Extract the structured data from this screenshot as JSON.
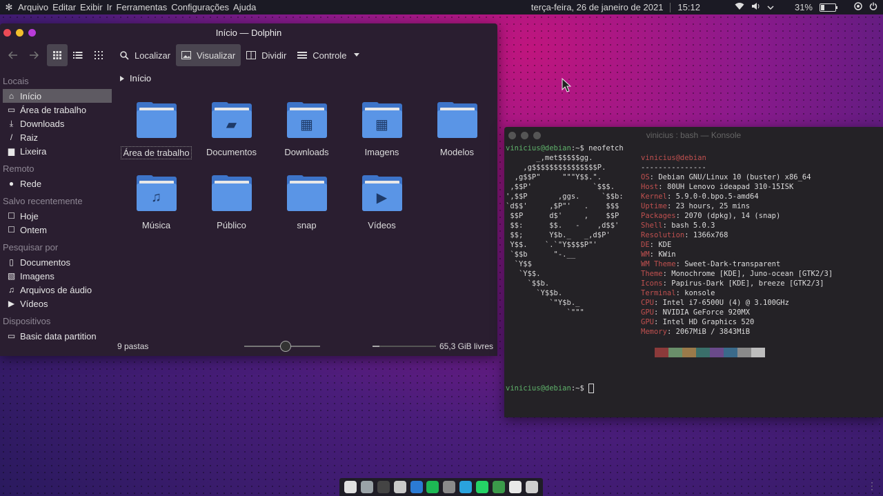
{
  "topbar": {
    "menu": [
      "Arquivo",
      "Editar",
      "Exibir",
      "Ir",
      "Ferramentas",
      "Configurações",
      "Ajuda"
    ],
    "datetime": "terça-feira, 26 de janeiro de 2021",
    "time": "15:12",
    "battery": "31%"
  },
  "dolphin": {
    "title": "Início — Dolphin",
    "toolbar": {
      "find": "Localizar",
      "preview": "Visualizar",
      "split": "Dividir",
      "control": "Controle"
    },
    "sidebar": {
      "sections": [
        {
          "title": "Locais",
          "items": [
            {
              "label": "Início",
              "icon": "home-icon",
              "selected": true
            },
            {
              "label": "Área de trabalho",
              "icon": "desktop-icon"
            },
            {
              "label": "Downloads",
              "icon": "download-icon"
            },
            {
              "label": "Raiz",
              "icon": "root-icon"
            },
            {
              "label": "Lixeira",
              "icon": "trash-icon"
            }
          ]
        },
        {
          "title": "Remoto",
          "items": [
            {
              "label": "Rede",
              "icon": "network-icon"
            }
          ]
        },
        {
          "title": "Salvo recentemente",
          "items": [
            {
              "label": "Hoje",
              "icon": "calendar-icon"
            },
            {
              "label": "Ontem",
              "icon": "calendar-icon"
            }
          ]
        },
        {
          "title": "Pesquisar por",
          "items": [
            {
              "label": "Documentos",
              "icon": "document-icon"
            },
            {
              "label": "Imagens",
              "icon": "image-icon"
            },
            {
              "label": "Arquivos de áudio",
              "icon": "audio-icon"
            },
            {
              "label": "Vídeos",
              "icon": "video-icon"
            }
          ]
        },
        {
          "title": "Dispositivos",
          "items": [
            {
              "label": "Basic data partition",
              "icon": "drive-icon"
            }
          ]
        }
      ]
    },
    "breadcrumb": "Início",
    "folders": [
      {
        "label": "Área de trabalho",
        "glyph": ""
      },
      {
        "label": "Documentos",
        "glyph": "▰"
      },
      {
        "label": "Downloads",
        "glyph": "▦"
      },
      {
        "label": "Imagens",
        "glyph": "▦"
      },
      {
        "label": "Modelos",
        "glyph": ""
      },
      {
        "label": "Música",
        "glyph": "♫"
      },
      {
        "label": "Público",
        "glyph": ""
      },
      {
        "label": "snap",
        "glyph": ""
      },
      {
        "label": "Vídeos",
        "glyph": "▶"
      }
    ],
    "status": {
      "count": "9 pastas",
      "free": "65,3 GiB livres"
    }
  },
  "konsole": {
    "title": "vinicius : bash — Konsole",
    "prompt": "vinicius@debian",
    "prompt_suffix": ":~$ ",
    "command": "neofetch",
    "user_host": "vinicius@debian",
    "separator": "---------------",
    "ascii": "       _,met$$$$$gg.\n    ,g$$$$$$$$$$$$$$$P.\n  ,g$$P\"     \"\"\"Y$$.\".\n ,$$P'              `$$$.\n',$$P       ,ggs.     `$$b:\n`d$$'     ,$P\"'   .    $$$\n $$P      d$'     ,    $$P\n $$:      $$.   -    ,d$$'\n $$;      Y$b._   _,d$P'\n Y$$.    `.`\"Y$$$$P\"'\n `$$b      \"-.__\n  `Y$$\n   `Y$$.\n     `$$b.\n       `Y$$b.\n          `\"Y$b._\n              `\"\"\"",
    "info": [
      {
        "k": "OS",
        "v": "Debian GNU/Linux 10 (buster) x86_64"
      },
      {
        "k": "Host",
        "v": "80UH Lenovo ideapad 310-15ISK"
      },
      {
        "k": "Kernel",
        "v": "5.9.0-0.bpo.5-amd64"
      },
      {
        "k": "Uptime",
        "v": "23 hours, 25 mins"
      },
      {
        "k": "Packages",
        "v": "2070 (dpkg), 14 (snap)"
      },
      {
        "k": "Shell",
        "v": "bash 5.0.3"
      },
      {
        "k": "Resolution",
        "v": "1366x768"
      },
      {
        "k": "DE",
        "v": "KDE"
      },
      {
        "k": "WM",
        "v": "KWin"
      },
      {
        "k": "WM Theme",
        "v": "Sweet-Dark-transparent"
      },
      {
        "k": "Theme",
        "v": "Monochrome [KDE], Juno-ocean [GTK2/3]"
      },
      {
        "k": "Icons",
        "v": "Papirus-Dark [KDE], breeze [GTK2/3]"
      },
      {
        "k": "Terminal",
        "v": "konsole"
      },
      {
        "k": "CPU",
        "v": "Intel i7-6500U (4) @ 3.100GHz"
      },
      {
        "k": "GPU",
        "v": "NVIDIA GeForce 920MX"
      },
      {
        "k": "GPU",
        "v": "Intel HD Graphics 520"
      },
      {
        "k": "Memory",
        "v": "2067MiB / 3843MiB"
      }
    ],
    "swatch_colors": [
      "#8b3a3a",
      "#6a8f6a",
      "#9a7a4a",
      "#3a6f6a",
      "#6a4a8a",
      "#3a6a8a",
      "#8a8a8a",
      "#bdbdbd"
    ]
  },
  "dock": {
    "apps": [
      {
        "name": "chrome-icon",
        "color": "#e0e0e0"
      },
      {
        "name": "files-icon",
        "color": "#9aa3a8"
      },
      {
        "name": "terminal-icon",
        "color": "#444"
      },
      {
        "name": "store-icon",
        "color": "#c9c9c9"
      },
      {
        "name": "vscode-icon",
        "color": "#2b7bd4"
      },
      {
        "name": "spotify-icon",
        "color": "#1db954"
      },
      {
        "name": "calculator-icon",
        "color": "#8a8a8a"
      },
      {
        "name": "telegram-icon",
        "color": "#2aa3dd"
      },
      {
        "name": "whatsapp-icon",
        "color": "#25d366"
      },
      {
        "name": "spreadsheet-icon",
        "color": "#3b9a4a"
      },
      {
        "name": "document-icon",
        "color": "#e8e8e8"
      },
      {
        "name": "settings-icon",
        "color": "#cfcfcf"
      }
    ]
  }
}
